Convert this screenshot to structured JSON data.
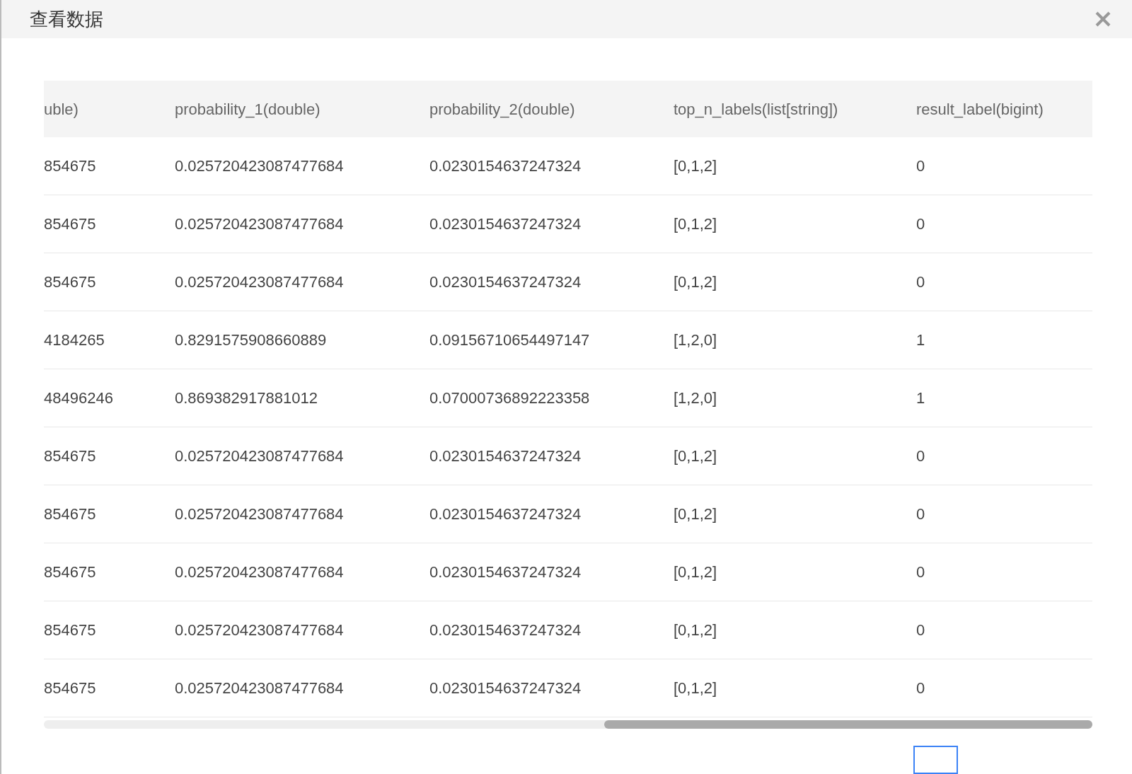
{
  "dialog": {
    "title": "查看数据"
  },
  "table": {
    "columns": [
      "uble)",
      "probability_1(double)",
      "probability_2(double)",
      "top_n_labels(list[string])",
      "result_label(bigint)"
    ],
    "rows": [
      [
        "854675",
        "0.025720423087477684",
        "0.0230154637247324",
        "[0,1,2]",
        "0"
      ],
      [
        "854675",
        "0.025720423087477684",
        "0.0230154637247324",
        "[0,1,2]",
        "0"
      ],
      [
        "854675",
        "0.025720423087477684",
        "0.0230154637247324",
        "[0,1,2]",
        "0"
      ],
      [
        "4184265",
        "0.8291575908660889",
        "0.09156710654497147",
        "[1,2,0]",
        "1"
      ],
      [
        "48496246",
        "0.869382917881012",
        "0.07000736892223358",
        "[1,2,0]",
        "1"
      ],
      [
        "854675",
        "0.025720423087477684",
        "0.0230154637247324",
        "[0,1,2]",
        "0"
      ],
      [
        "854675",
        "0.025720423087477684",
        "0.0230154637247324",
        "[0,1,2]",
        "0"
      ],
      [
        "854675",
        "0.025720423087477684",
        "0.0230154637247324",
        "[0,1,2]",
        "0"
      ],
      [
        "854675",
        "0.025720423087477684",
        "0.0230154637247324",
        "[0,1,2]",
        "0"
      ],
      [
        "854675",
        "0.025720423087477684",
        "0.0230154637247324",
        "[0,1,2]",
        "0"
      ]
    ]
  }
}
